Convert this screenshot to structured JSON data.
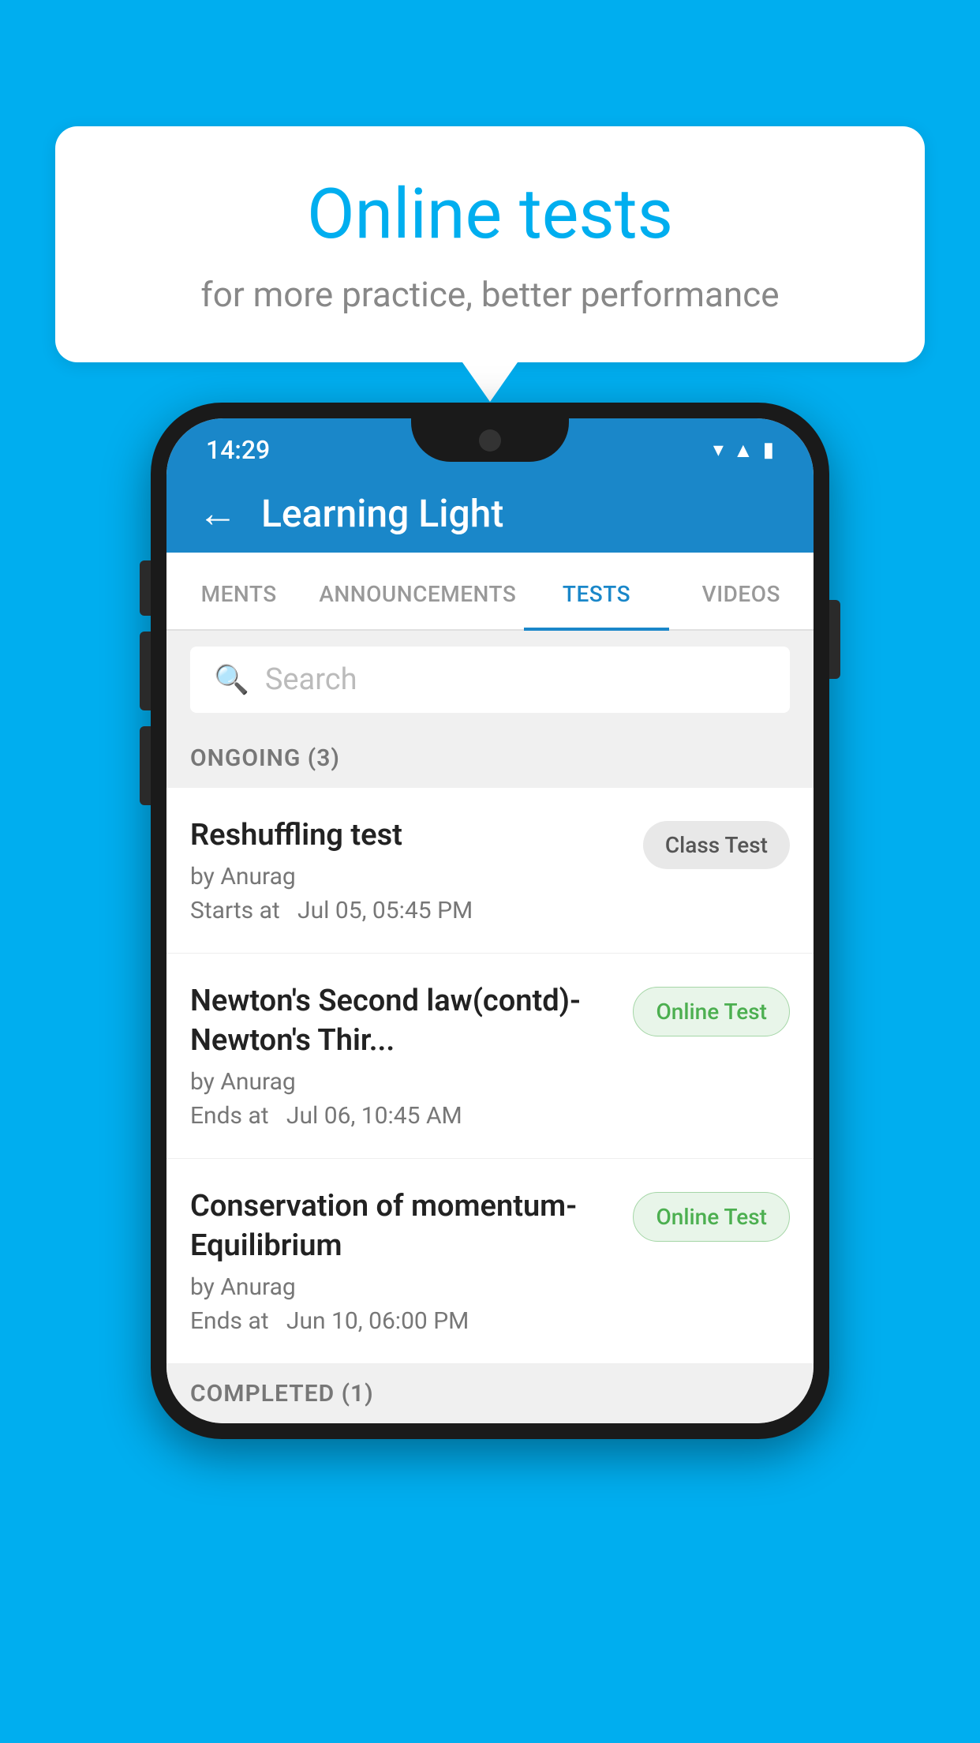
{
  "background_color": "#00AEEF",
  "speech_bubble": {
    "title": "Online tests",
    "subtitle": "for more practice, better performance"
  },
  "status_bar": {
    "time": "14:29",
    "icons": [
      "wifi",
      "signal",
      "battery"
    ]
  },
  "app_header": {
    "back_label": "←",
    "title": "Learning Light"
  },
  "tabs": [
    {
      "label": "MENTS",
      "active": false
    },
    {
      "label": "ANNOUNCEMENTS",
      "active": false
    },
    {
      "label": "TESTS",
      "active": true
    },
    {
      "label": "VIDEOS",
      "active": false
    }
  ],
  "search": {
    "placeholder": "Search"
  },
  "ongoing_section": {
    "label": "ONGOING (3)"
  },
  "test_items": [
    {
      "name": "Reshuffling test",
      "author": "by Anurag",
      "date_label": "Starts at",
      "date": "Jul 05, 05:45 PM",
      "badge": "Class Test",
      "badge_type": "class"
    },
    {
      "name": "Newton's Second law(contd)-Newton's Thir...",
      "author": "by Anurag",
      "date_label": "Ends at",
      "date": "Jul 06, 10:45 AM",
      "badge": "Online Test",
      "badge_type": "online"
    },
    {
      "name": "Conservation of momentum-Equilibrium",
      "author": "by Anurag",
      "date_label": "Ends at",
      "date": "Jun 10, 06:00 PM",
      "badge": "Online Test",
      "badge_type": "online"
    }
  ],
  "completed_section": {
    "label": "COMPLETED (1)"
  }
}
